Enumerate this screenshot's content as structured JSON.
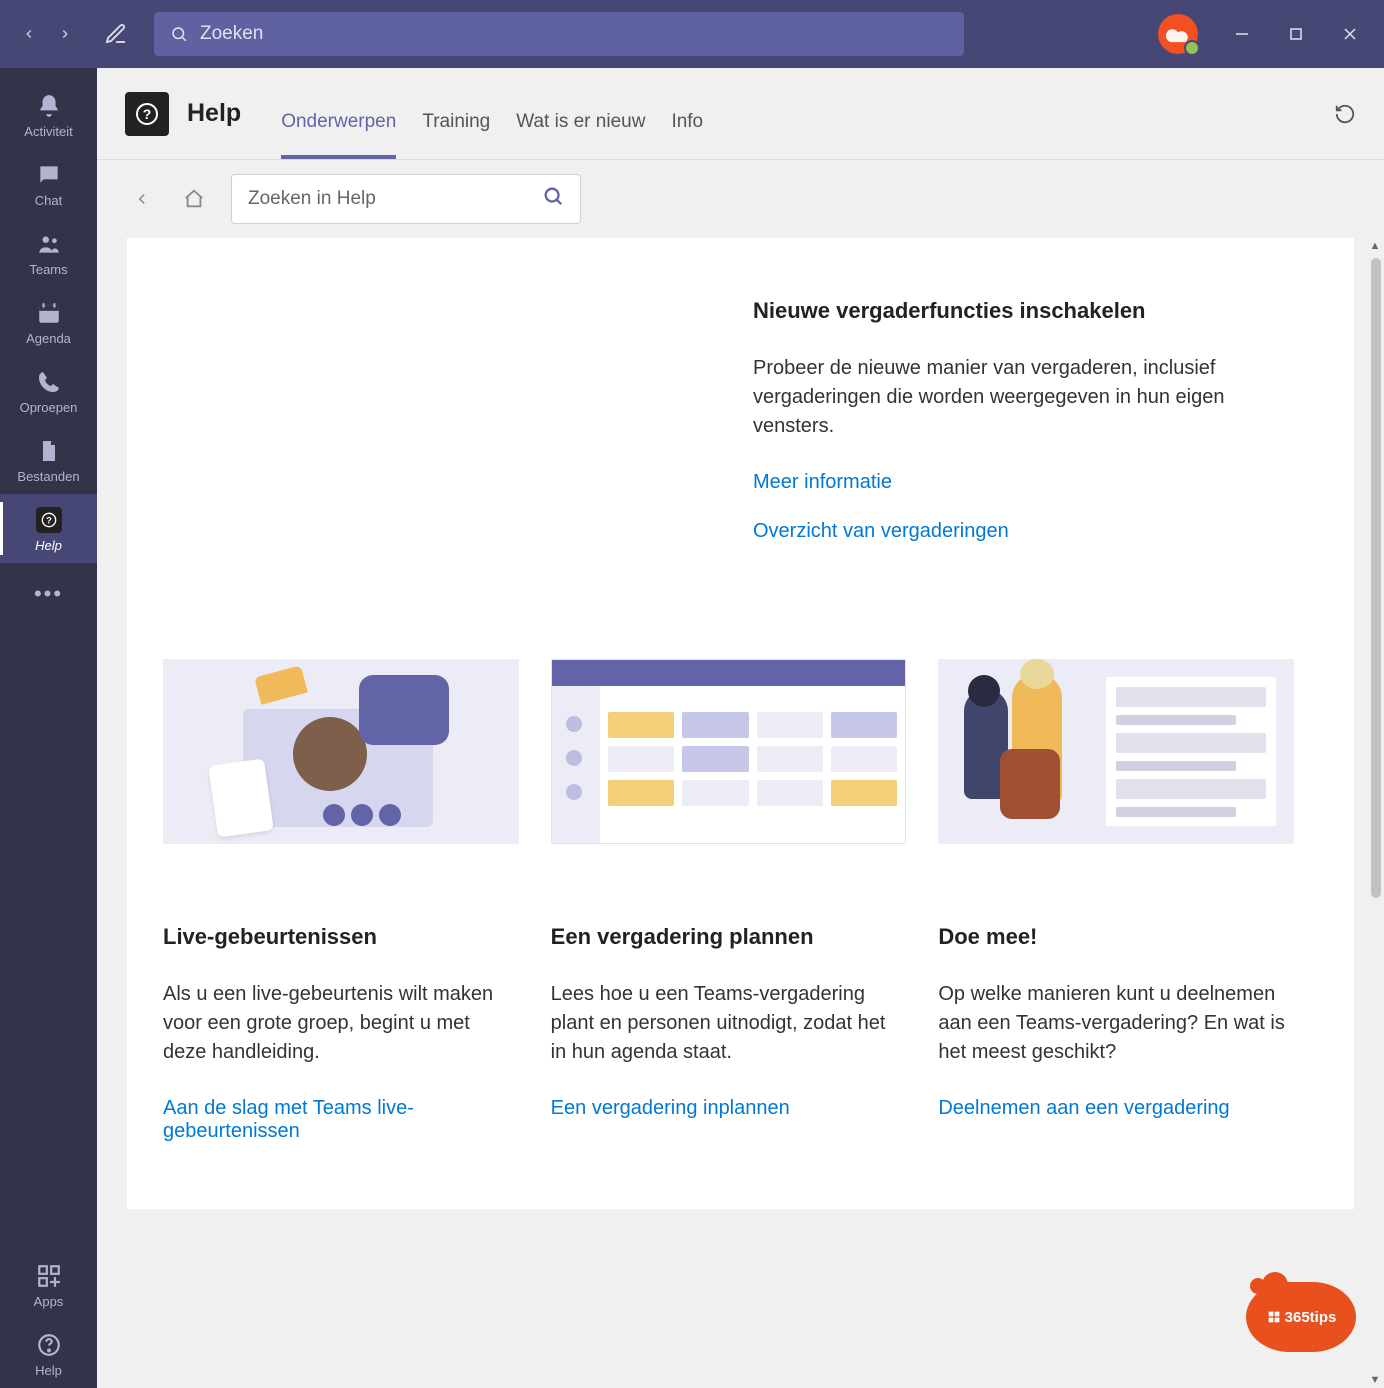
{
  "titlebar": {
    "search_placeholder": "Zoeken"
  },
  "rail": {
    "items": [
      {
        "label": "Activiteit"
      },
      {
        "label": "Chat"
      },
      {
        "label": "Teams"
      },
      {
        "label": "Agenda"
      },
      {
        "label": "Oproepen"
      },
      {
        "label": "Bestanden"
      },
      {
        "label": "Help"
      }
    ],
    "bottom": [
      {
        "label": "Apps"
      },
      {
        "label": "Help"
      }
    ]
  },
  "header": {
    "title": "Help",
    "tabs": [
      {
        "label": "Onderwerpen"
      },
      {
        "label": "Training"
      },
      {
        "label": "Wat is er nieuw"
      },
      {
        "label": "Info"
      }
    ]
  },
  "subheader": {
    "search_placeholder": "Zoeken in Help"
  },
  "feature": {
    "title": "Nieuwe vergaderfuncties inschakelen",
    "desc": "Probeer de nieuwe manier van vergaderen, inclusief vergaderingen die worden weergegeven in hun eigen vensters.",
    "link1": "Meer informatie",
    "link2": "Overzicht van vergaderingen"
  },
  "cards": [
    {
      "title": "Live-gebeurtenissen",
      "desc": "Als u een live-gebeurtenis wilt maken voor een grote groep, begint u met deze handleiding.",
      "link": "Aan de slag met Teams live-gebeurtenissen"
    },
    {
      "title": "Een vergadering plannen",
      "desc": "Lees hoe u een Teams-vergadering plant en personen uitnodigt, zodat het in hun agenda staat.",
      "link": "Een vergadering inplannen"
    },
    {
      "title": "Doe mee!",
      "desc": "Op welke manieren kunt u deelnemen aan een Teams-vergadering? En wat is het meest geschikt?",
      "link": "Deelnemen aan een vergadering"
    }
  ],
  "badge": {
    "text": "365tips"
  }
}
